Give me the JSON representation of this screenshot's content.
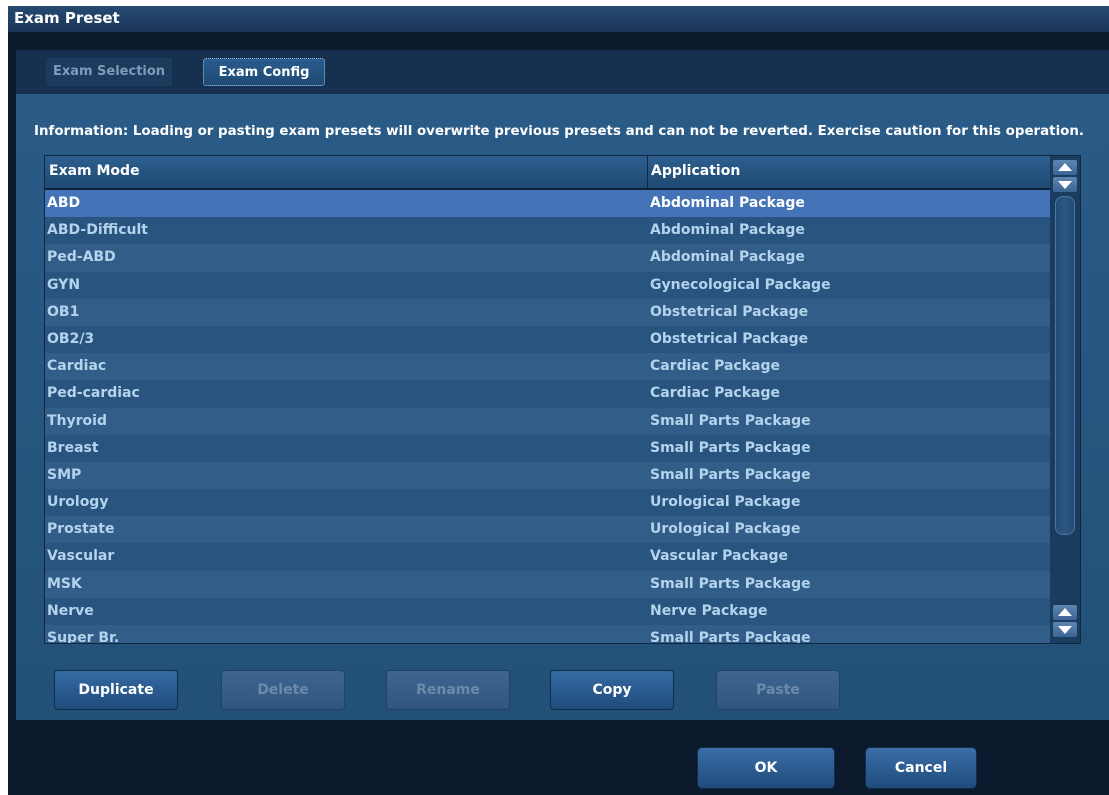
{
  "window": {
    "title": "Exam Preset"
  },
  "tabs": [
    {
      "label": "Exam Selection",
      "active": false
    },
    {
      "label": "Exam Config",
      "active": true
    }
  ],
  "info_text": "Information: Loading or pasting exam presets will overwrite previous presets and can not be reverted. Exercise caution for this operation.",
  "table": {
    "headers": {
      "mode": "Exam Mode",
      "application": "Application"
    },
    "rows": [
      {
        "mode": "ABD",
        "application": "Abdominal Package",
        "selected": true
      },
      {
        "mode": "ABD-Difficult",
        "application": "Abdominal Package"
      },
      {
        "mode": "Ped-ABD",
        "application": "Abdominal Package"
      },
      {
        "mode": "GYN",
        "application": "Gynecological Package"
      },
      {
        "mode": "OB1",
        "application": "Obstetrical Package"
      },
      {
        "mode": "OB2/3",
        "application": "Obstetrical Package"
      },
      {
        "mode": "Cardiac",
        "application": "Cardiac Package"
      },
      {
        "mode": "Ped-cardiac",
        "application": "Cardiac Package"
      },
      {
        "mode": "Thyroid",
        "application": "Small Parts Package"
      },
      {
        "mode": "Breast",
        "application": "Small Parts Package"
      },
      {
        "mode": "SMP",
        "application": "Small Parts Package"
      },
      {
        "mode": "Urology",
        "application": "Urological Package"
      },
      {
        "mode": "Prostate",
        "application": "Urological Package"
      },
      {
        "mode": "Vascular",
        "application": "Vascular Package"
      },
      {
        "mode": "MSK",
        "application": "Small Parts Package"
      },
      {
        "mode": "Nerve",
        "application": "Nerve Package"
      },
      {
        "mode": "Super Br.",
        "application": "Small Parts Package"
      }
    ]
  },
  "actions": {
    "duplicate": {
      "label": "Duplicate",
      "enabled": true
    },
    "delete": {
      "label": "Delete",
      "enabled": false
    },
    "rename": {
      "label": "Rename",
      "enabled": false
    },
    "copy": {
      "label": "Copy",
      "enabled": true
    },
    "paste": {
      "label": "Paste",
      "enabled": false
    }
  },
  "footer": {
    "ok_label": "OK",
    "cancel_label": "Cancel"
  },
  "colors": {
    "selected_row": "#4474b7",
    "row_text": "#b3d4ec",
    "panel": "#2a5b87"
  }
}
